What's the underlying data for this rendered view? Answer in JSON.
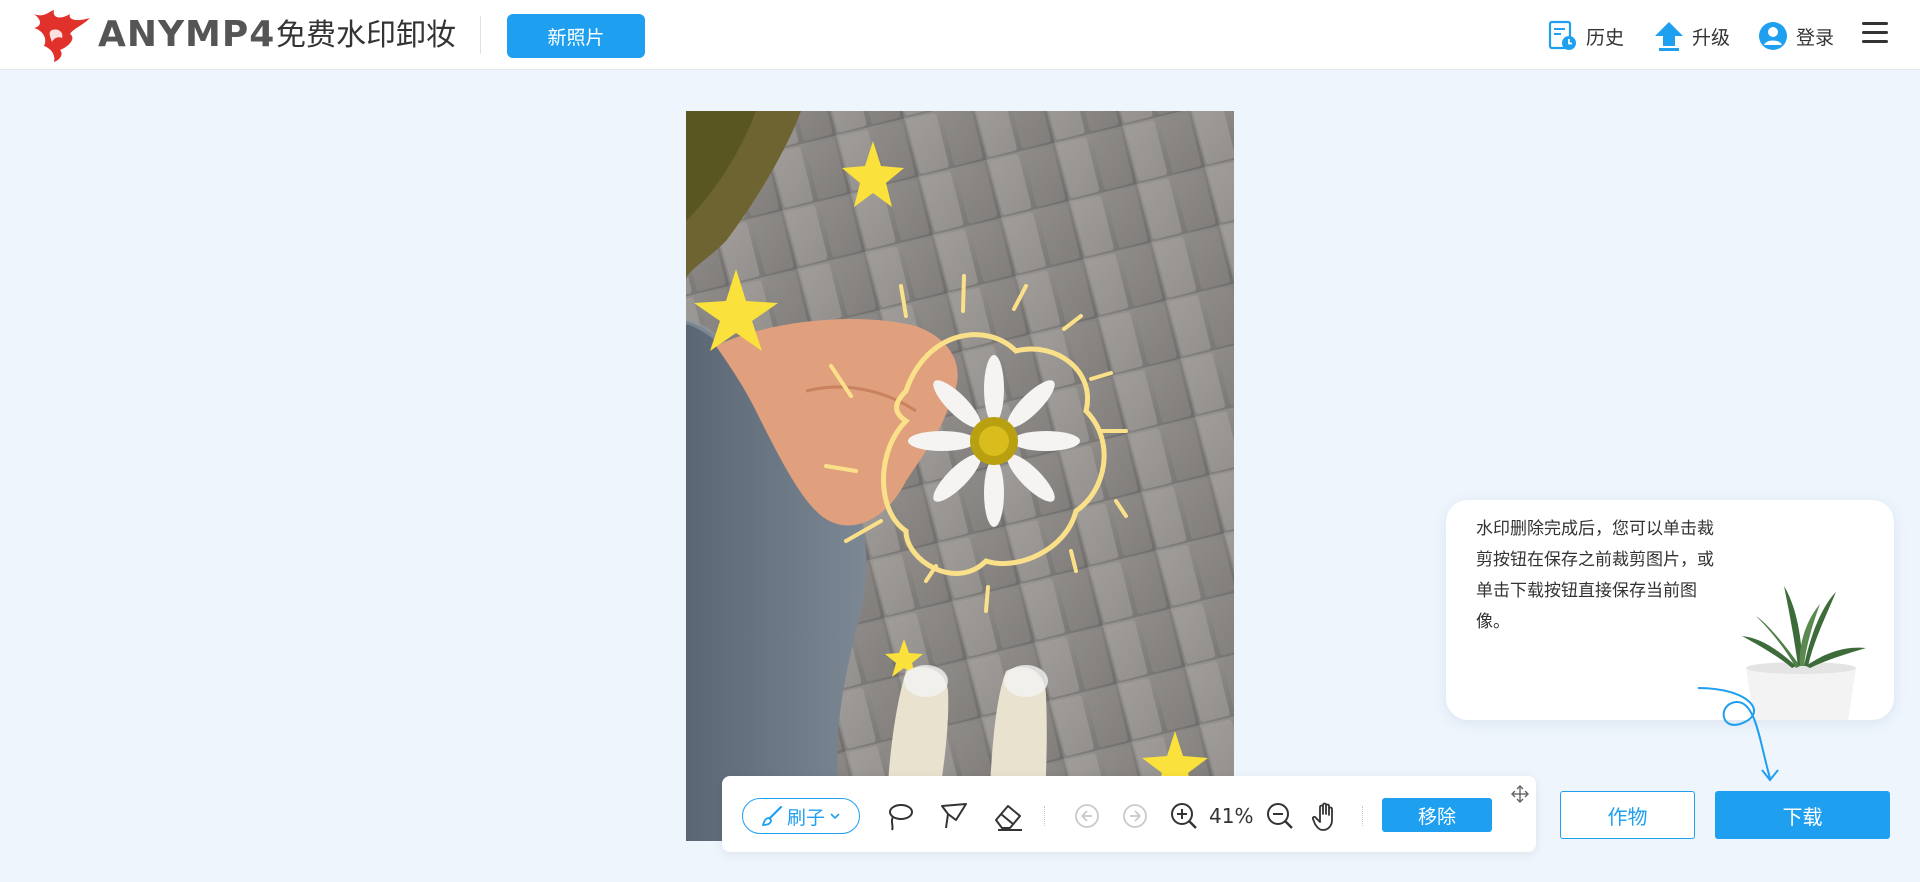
{
  "header": {
    "brand": "ANYMP4",
    "product": "免费水印卸妆",
    "new_photo_label": "新照片",
    "history_label": "历史",
    "upgrade_label": "升级",
    "login_label": "登录"
  },
  "toolbar": {
    "brush_label": "刷子",
    "zoom_level": "41%",
    "remove_label": "移除"
  },
  "tip": {
    "text": "水印删除完成后，您可以单击裁剪按钮在保存之前裁剪图片，或单击下载按钮直接保存当前图像。"
  },
  "actions": {
    "crop_label": "作物",
    "download_label": "下载"
  },
  "colors": {
    "accent": "#1f9ff0",
    "background": "#eef5fd",
    "logo_red": "#e0312b"
  },
  "icons": {
    "history": "history-icon",
    "upgrade": "upgrade-arrow-icon",
    "login": "user-avatar-icon",
    "menu": "hamburger-menu-icon",
    "brush": "brush-icon",
    "lasso": "lasso-icon",
    "polygon": "polygon-lasso-icon",
    "eraser": "eraser-icon",
    "undo": "undo-icon",
    "redo": "redo-icon",
    "zoom_in": "zoom-in-icon",
    "zoom_out": "zoom-out-icon",
    "hand": "hand-pan-icon",
    "move": "move-icon"
  }
}
